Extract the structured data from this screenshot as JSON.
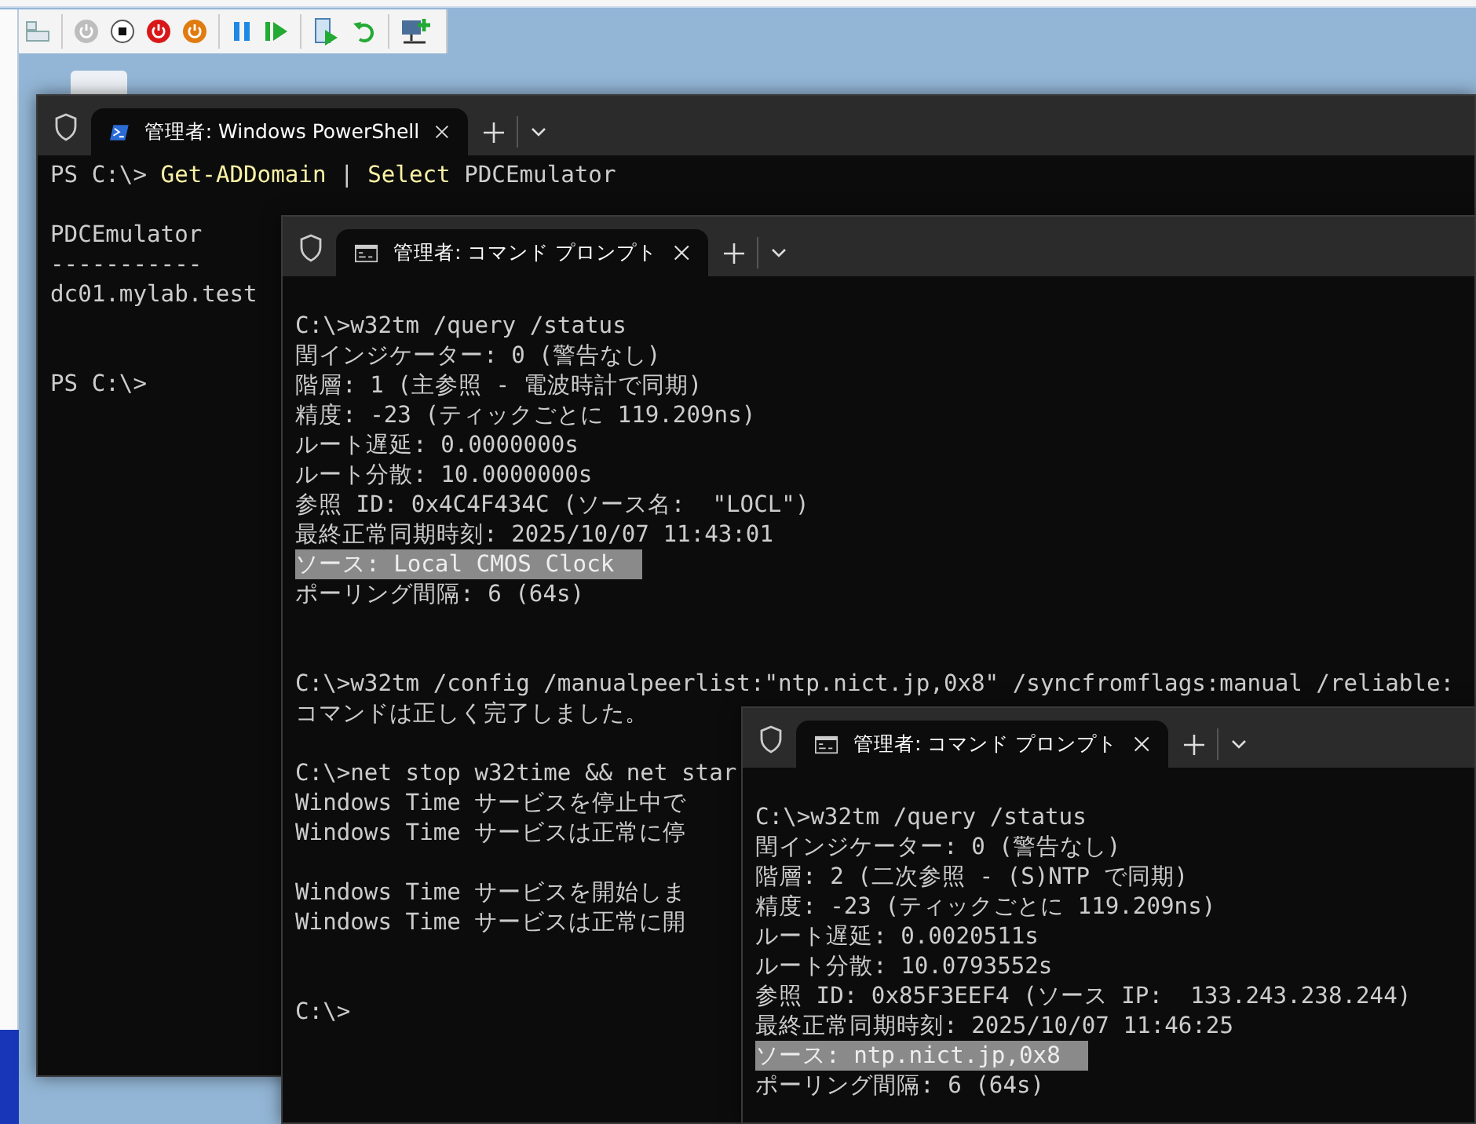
{
  "windows": [
    {
      "kind": "powershell",
      "tab": {
        "title": "管理者: Windows PowerShell",
        "selected": true
      },
      "lines": [
        {
          "kind": "text",
          "segments": [
            {
              "text": "PS C:\\> ",
              "kind": "plain"
            },
            {
              "text": "Get-ADDomain",
              "kind": "command"
            },
            {
              "text": " | ",
              "kind": "plain"
            },
            {
              "text": "Select",
              "kind": "command"
            },
            {
              "text": " PDCEmulator",
              "kind": "plain"
            }
          ]
        },
        {
          "kind": "blank"
        },
        {
          "kind": "text",
          "text": "PDCEmulator"
        },
        {
          "kind": "text",
          "text": "-----------"
        },
        {
          "kind": "text",
          "text": "dc01.mylab.test"
        },
        {
          "kind": "blank"
        },
        {
          "kind": "blank"
        },
        {
          "kind": "text",
          "text": "PS C:\\>"
        }
      ]
    },
    {
      "kind": "cmd",
      "tab": {
        "title": "管理者: コマンド プロンプト",
        "selected": true
      },
      "lines": [
        {
          "kind": "blank"
        },
        {
          "kind": "text",
          "text": "C:\\>w32tm /query /status"
        },
        {
          "kind": "text",
          "text": "閏インジケーター: 0 (警告なし)"
        },
        {
          "kind": "text",
          "text": "階層: 1 (主参照 - 電波時計で同期)"
        },
        {
          "kind": "text",
          "text": "精度: -23 (ティックごとに 119.209ns)"
        },
        {
          "kind": "text",
          "text": "ルート遅延: 0.0000000s"
        },
        {
          "kind": "text",
          "text": "ルート分散: 10.0000000s"
        },
        {
          "kind": "text",
          "text": "参照 ID: 0x4C4F434C (ソース名:  \"LOCL\")"
        },
        {
          "kind": "text",
          "text": "最終正常同期時刻: 2025/10/07 11:43:01"
        },
        {
          "kind": "text",
          "text": "ソース: Local CMOS Clock",
          "highlighted": true
        },
        {
          "kind": "text",
          "text": "ポーリング間隔: 6 (64s)"
        },
        {
          "kind": "blank"
        },
        {
          "kind": "blank"
        },
        {
          "kind": "text",
          "text": "C:\\>w32tm /config /manualpeerlist:\"ntp.nict.jp,0x8\" /syncfromflags:manual /reliable:"
        },
        {
          "kind": "text",
          "text": "コマンドは正しく完了しました。"
        },
        {
          "kind": "blank"
        },
        {
          "kind": "text",
          "text": "C:\\>net stop w32time && net star"
        },
        {
          "kind": "text",
          "text": "Windows Time サービスを停止中で"
        },
        {
          "kind": "text",
          "text": "Windows Time サービスは正常に停"
        },
        {
          "kind": "blank"
        },
        {
          "kind": "text",
          "text": "Windows Time サービスを開始しま"
        },
        {
          "kind": "text",
          "text": "Windows Time サービスは正常に開"
        },
        {
          "kind": "blank"
        },
        {
          "kind": "blank"
        },
        {
          "kind": "text",
          "text": "C:\\>"
        }
      ]
    },
    {
      "kind": "cmd",
      "tab": {
        "title": "管理者: コマンド プロンプト",
        "selected": true
      },
      "lines": [
        {
          "kind": "blank"
        },
        {
          "kind": "text",
          "text": "C:\\>w32tm /query /status"
        },
        {
          "kind": "text",
          "text": "閏インジケーター: 0 (警告なし)"
        },
        {
          "kind": "text",
          "text": "階層: 2 (二次参照 - (S)NTP で同期)"
        },
        {
          "kind": "text",
          "text": "精度: -23 (ティックごとに 119.209ns)"
        },
        {
          "kind": "text",
          "text": "ルート遅延: 0.0020511s"
        },
        {
          "kind": "text",
          "text": "ルート分散: 10.0793552s"
        },
        {
          "kind": "text",
          "text": "参照 ID: 0x85F3EEF4 (ソース IP:  133.243.238.244)"
        },
        {
          "kind": "text",
          "text": "最終正常同期時刻: 2025/10/07 11:46:25"
        },
        {
          "kind": "text",
          "text": "ソース: ntp.nict.jp,0x8",
          "highlighted": true
        },
        {
          "kind": "text",
          "text": "ポーリング間隔: 6 (64s)"
        }
      ]
    }
  ]
}
